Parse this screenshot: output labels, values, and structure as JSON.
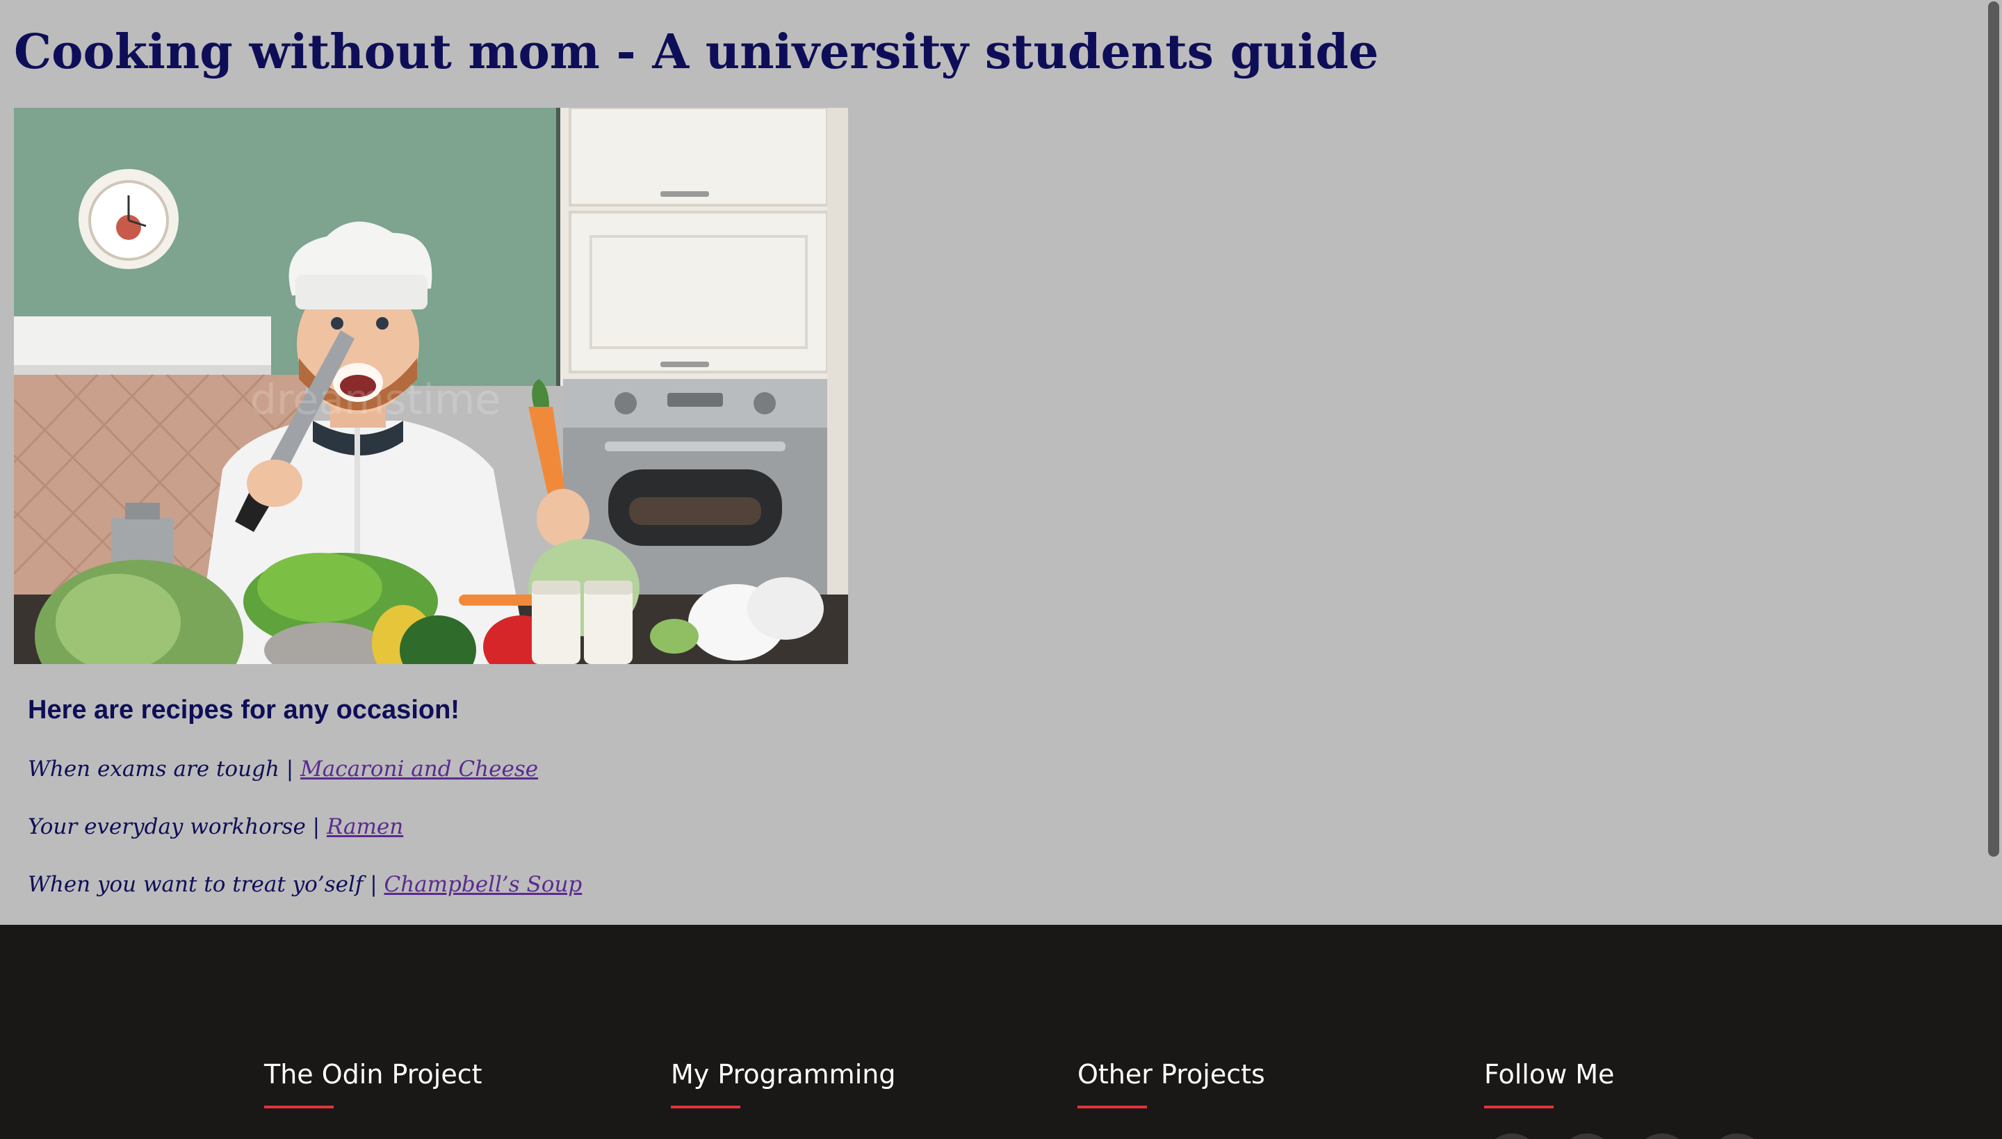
{
  "page": {
    "title": "Cooking without mom - A university students guide"
  },
  "hero": {
    "image_alt": "Smiling chef in a kitchen holding a knife and a carrot",
    "watermark": "dreamstime"
  },
  "recipes": {
    "heading": "Here are recipes for any occasion!",
    "items": [
      {
        "prefix": "When exams are tough | ",
        "link": "Macaroni and Cheese"
      },
      {
        "prefix": "Your everyday workhorse | ",
        "link": "Ramen"
      },
      {
        "prefix": "When you want to treat yo’self | ",
        "link": "Champbell’s Soup"
      }
    ]
  },
  "footer": {
    "columns": [
      {
        "heading": "The Odin Project"
      },
      {
        "heading": "My Programming"
      },
      {
        "heading": "Other Projects"
      },
      {
        "heading": "Follow Me"
      }
    ]
  },
  "colors": {
    "background": "#bcbcbc",
    "heading_text": "#0e0e58",
    "link": "#5a2b8f",
    "footer_bg": "#1a1717",
    "footer_accent": "#e0343a"
  }
}
